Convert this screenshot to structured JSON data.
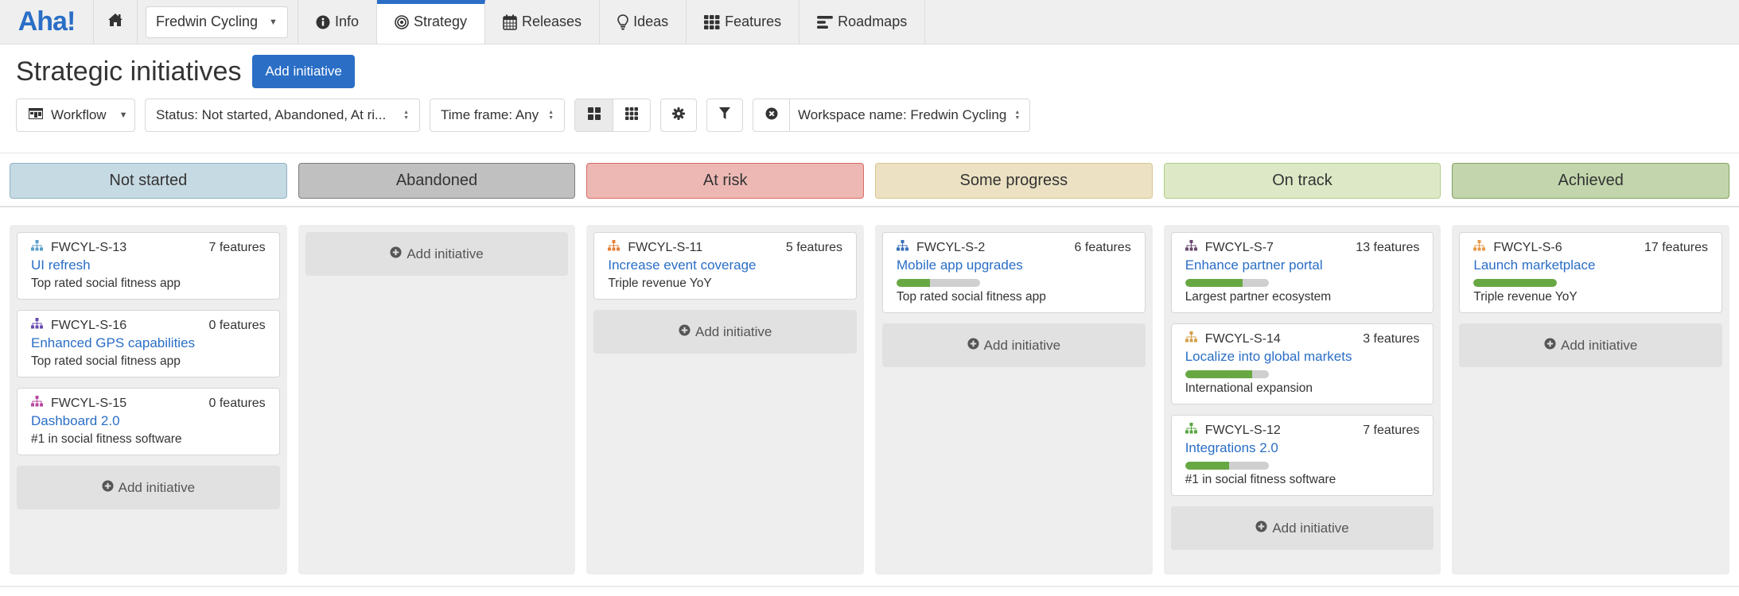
{
  "nav": {
    "logo": "Aha!",
    "workspace": "Fredwin Cycling",
    "tabs": [
      {
        "label": "Info",
        "icon": "info-circle-icon",
        "active": false
      },
      {
        "label": "Strategy",
        "icon": "bullseye-icon",
        "active": true
      },
      {
        "label": "Releases",
        "icon": "calendar-icon",
        "active": false
      },
      {
        "label": "Ideas",
        "icon": "lightbulb-icon",
        "active": false
      },
      {
        "label": "Features",
        "icon": "grid-icon",
        "active": false
      },
      {
        "label": "Roadmaps",
        "icon": "roadmap-bars-icon",
        "active": false
      }
    ]
  },
  "header": {
    "title": "Strategic initiatives",
    "add_button": "Add initiative"
  },
  "toolbar": {
    "view": "Workflow",
    "status_filter": "Status: Not started, Abandoned, At ri...",
    "timeframe_filter": "Time frame: Any",
    "workspace_filter": "Workspace name: Fredwin Cycling"
  },
  "colors": {
    "accent": "#2a6ec6",
    "progress_fill": "#67a843",
    "progress_track": "#cfcfcf"
  },
  "add_initiative_label": "Add initiative",
  "columns": [
    {
      "status": "Not started",
      "bg": "#c6dae3",
      "border": "#8fb3c4",
      "cards": [
        {
          "id": "FWCYL-S-13",
          "features": "7 features",
          "title": "UI refresh",
          "goal": "Top rated social fitness app",
          "icon_color": "#5b9ec9",
          "progress": null
        },
        {
          "id": "FWCYL-S-16",
          "features": "0 features",
          "title": "Enhanced GPS capabilities",
          "goal": "Top rated social fitness app",
          "icon_color": "#6a4bb0",
          "progress": null
        },
        {
          "id": "FWCYL-S-15",
          "features": "0 features",
          "title": "Dashboard 2.0",
          "goal": "#1 in social fitness software",
          "icon_color": "#b84aa0",
          "progress": null
        }
      ]
    },
    {
      "status": "Abandoned",
      "bg": "#c0c0c0",
      "border": "#7d7d7d",
      "cards": []
    },
    {
      "status": "At risk",
      "bg": "#edb8b4",
      "border": "#d96a62",
      "cards": [
        {
          "id": "FWCYL-S-11",
          "features": "5 features",
          "title": "Increase event coverage",
          "goal": "Triple revenue YoY",
          "icon_color": "#e5803a",
          "progress": null
        }
      ]
    },
    {
      "status": "Some progress",
      "bg": "#ece2c3",
      "border": "#d8c58f",
      "cards": [
        {
          "id": "FWCYL-S-2",
          "features": "6 features",
          "title": "Mobile app upgrades",
          "goal": "Top rated social fitness app",
          "icon_color": "#3a6fb8",
          "progress": 40
        }
      ]
    },
    {
      "status": "On track",
      "bg": "#dde9c6",
      "border": "#b0cd88",
      "cards": [
        {
          "id": "FWCYL-S-7",
          "features": "13 features",
          "title": "Enhance partner portal",
          "goal": "Largest partner ecosystem",
          "icon_color": "#6b4a6e",
          "progress": 69
        },
        {
          "id": "FWCYL-S-14",
          "features": "3 features",
          "title": "Localize into global markets",
          "goal": "International expansion",
          "icon_color": "#d4a04a",
          "progress": 80
        },
        {
          "id": "FWCYL-S-12",
          "features": "7 features",
          "title": "Integrations 2.0",
          "goal": "#1 in social fitness software",
          "icon_color": "#58a640",
          "progress": 53
        }
      ]
    },
    {
      "status": "Achieved",
      "bg": "#c2d5ac",
      "border": "#7fa25b",
      "cards": [
        {
          "id": "FWCYL-S-6",
          "features": "17 features",
          "title": "Launch marketplace",
          "goal": "Triple revenue YoY",
          "icon_color": "#e89a4a",
          "progress": 100
        }
      ]
    }
  ]
}
